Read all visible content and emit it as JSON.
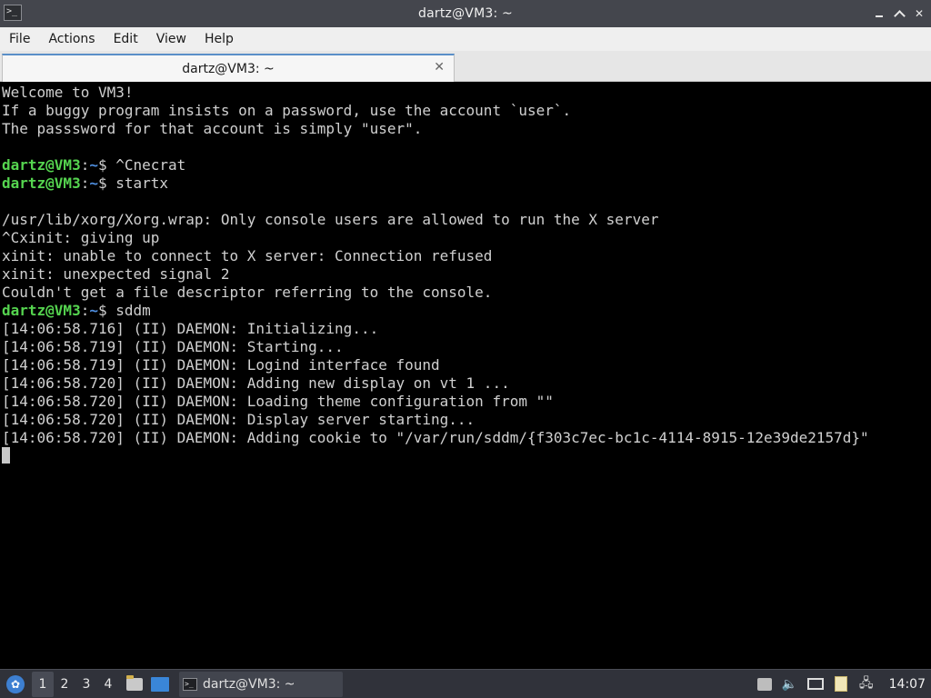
{
  "window": {
    "title": "dartz@VM3: ~",
    "close_glyph": "✕"
  },
  "menubar": {
    "items": [
      "File",
      "Actions",
      "Edit",
      "View",
      "Help"
    ]
  },
  "tabs": [
    {
      "label": "dartz@VM3: ~",
      "close_glyph": "✕"
    }
  ],
  "terminal": {
    "colors": {
      "prompt_user": "#55d44f",
      "prompt_path": "#4f8fe0",
      "text": "#d0d0d0",
      "background": "#000000"
    },
    "lines": [
      {
        "text": "Welcome to VM3!"
      },
      {
        "text": "If a buggy program insists on a password, use the account `user`."
      },
      {
        "text": "The passsword for that account is simply \"user\"."
      },
      {
        "text": ""
      },
      {
        "prompt": {
          "user": "dartz@VM3",
          "sep": ":",
          "path": "~",
          "symbol": "$ "
        },
        "text": "^Cnecrat"
      },
      {
        "prompt": {
          "user": "dartz@VM3",
          "sep": ":",
          "path": "~",
          "symbol": "$ "
        },
        "text": "startx"
      },
      {
        "text": ""
      },
      {
        "text": "/usr/lib/xorg/Xorg.wrap: Only console users are allowed to run the X server"
      },
      {
        "text": "^Cxinit: giving up"
      },
      {
        "text": "xinit: unable to connect to X server: Connection refused"
      },
      {
        "text": "xinit: unexpected signal 2"
      },
      {
        "text": "Couldn't get a file descriptor referring to the console."
      },
      {
        "prompt": {
          "user": "dartz@VM3",
          "sep": ":",
          "path": "~",
          "symbol": "$ "
        },
        "text": "sddm"
      },
      {
        "text": "[14:06:58.716] (II) DAEMON: Initializing..."
      },
      {
        "text": "[14:06:58.719] (II) DAEMON: Starting..."
      },
      {
        "text": "[14:06:58.719] (II) DAEMON: Logind interface found"
      },
      {
        "text": "[14:06:58.720] (II) DAEMON: Adding new display on vt 1 ..."
      },
      {
        "text": "[14:06:58.720] (II) DAEMON: Loading theme configuration from \"\""
      },
      {
        "text": "[14:06:58.720] (II) DAEMON: Display server starting..."
      },
      {
        "text": "[14:06:58.720] (II) DAEMON: Adding cookie to \"/var/run/sddm/{f303c7ec-bc1c-4114-8915-12e39de2157d}\""
      }
    ]
  },
  "taskbar": {
    "desktops": [
      "1",
      "2",
      "3",
      "4"
    ],
    "active_desktop": "1",
    "task_label": "dartz@VM3: ~",
    "clock": "14:07"
  }
}
